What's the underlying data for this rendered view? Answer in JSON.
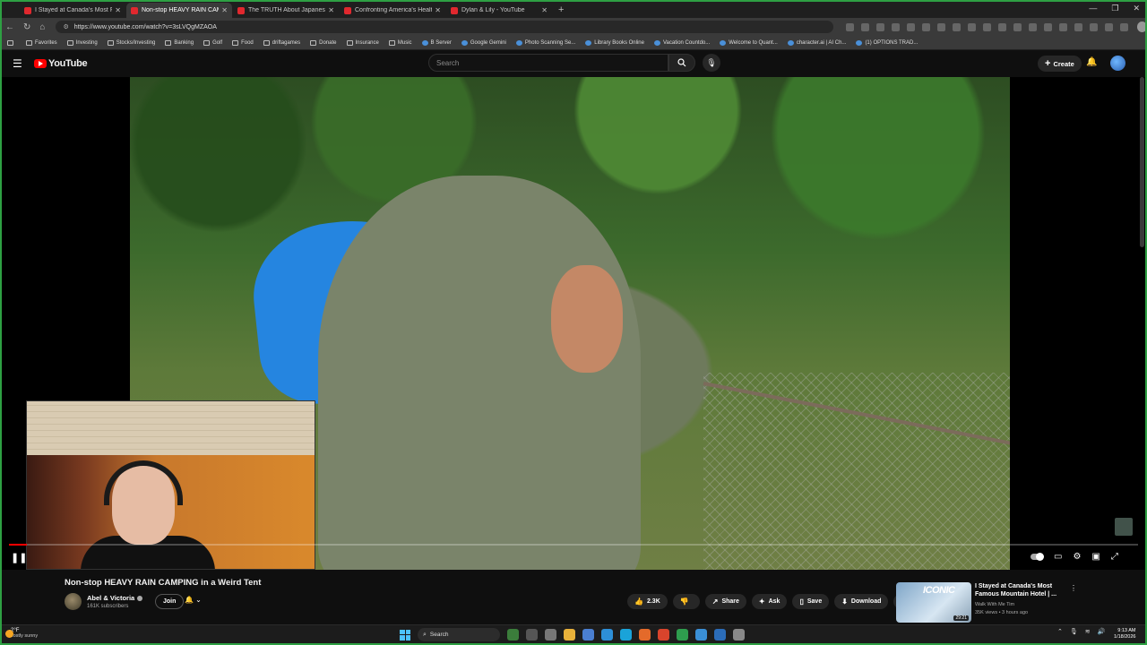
{
  "browser": {
    "tabs": [
      {
        "title": "I Stayed at Canada's Most Famou",
        "active": false
      },
      {
        "title": "Non-stop HEAVY RAIN CAMP",
        "active": true
      },
      {
        "title": "The TRUTH About Japanese Futon",
        "active": false
      },
      {
        "title": "Confronting America's Health Epi",
        "active": false
      },
      {
        "title": "Dylan & Lily - YouTube",
        "active": false
      }
    ],
    "new_tab": "+",
    "url": "https://www.youtube.com/watch?v=3sLVQgMZAOA",
    "bookmarks": [
      "Favorites",
      "Investing",
      "Stocks/Investing",
      "Banking",
      "Golf",
      "Food",
      "driftagames",
      "Donate",
      "Insurance",
      "Music",
      "B Server",
      "Google Gemini",
      "Photo Scanning Se...",
      "Library Books Online",
      "Vacation Countdo...",
      "Welcome to Quant...",
      "character.ai | AI Ch...",
      "(1) OPTIONS TRAD..."
    ]
  },
  "youtube": {
    "logo_text": "YouTube",
    "search_placeholder": "Search",
    "create_label": "Create",
    "brand_color": "#ff0000"
  },
  "player": {
    "progress_fraction": 0.016,
    "state": "playing"
  },
  "video": {
    "title": "Non-stop HEAVY RAIN CAMPING in a Weird Tent",
    "channel": "Abel & Victoria",
    "subscribers": "161K subscribers",
    "join_label": "Join",
    "likes": "2.3K",
    "share_label": "Share",
    "ask_label": "Ask",
    "save_label": "Save",
    "download_label": "Download"
  },
  "recommendation": {
    "thumb_text": "ICONIC",
    "duration": "29:21",
    "title": "I Stayed at Canada's Most Famous Mountain Hotel | ...",
    "channel": "Walk With Me Tim",
    "meta": "35K views • 3 hours ago"
  },
  "taskbar": {
    "temperature": "-2°F",
    "weather": "Mostly sunny",
    "search_label": "Search",
    "time": "9:13 AM",
    "date": "1/18/2026"
  }
}
